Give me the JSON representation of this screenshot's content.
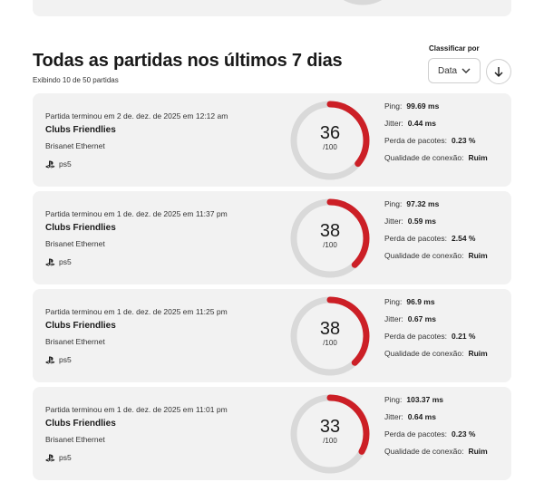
{
  "header": {
    "title": "Todas as partidas nos últimos 7 dias",
    "subtitle": "Exibindo 10 de 50 partidas",
    "sort_label": "Classificar por",
    "sort_value": "Data"
  },
  "colors": {
    "accent": "#cc1f26",
    "track": "#d9d9d9",
    "card": "#f2f2f2"
  },
  "labels": {
    "ping": "Ping:",
    "jitter": "Jitter:",
    "packet_loss": "Perda de pacotes:",
    "quality": "Qualidade de conexão:",
    "score_max": "/100"
  },
  "matches": [
    {
      "ended": "Partida terminou em 2 de. dez. de 2025 em 12:12 am",
      "mode": "Clubs Friendlies",
      "network": "Brisanet Ethernet",
      "platform": "ps5",
      "score": "36",
      "score_value": 36,
      "ping": "99.69 ms",
      "jitter": "0.44 ms",
      "loss": "0.23 %",
      "quality": "Ruim"
    },
    {
      "ended": "Partida terminou em 1 de. dez. de 2025 em 11:37 pm",
      "mode": "Clubs Friendlies",
      "network": "Brisanet Ethernet",
      "platform": "ps5",
      "score": "38",
      "score_value": 38,
      "ping": "97.32 ms",
      "jitter": "0.59 ms",
      "loss": "2.54 %",
      "quality": "Ruim"
    },
    {
      "ended": "Partida terminou em 1 de. dez. de 2025 em 11:25 pm",
      "mode": "Clubs Friendlies",
      "network": "Brisanet Ethernet",
      "platform": "ps5",
      "score": "38",
      "score_value": 38,
      "ping": "96.9 ms",
      "jitter": "0.67 ms",
      "loss": "0.21 %",
      "quality": "Ruim"
    },
    {
      "ended": "Partida terminou em 1 de. dez. de 2025 em 11:01 pm",
      "mode": "Clubs Friendlies",
      "network": "Brisanet Ethernet",
      "platform": "ps5",
      "score": "33",
      "score_value": 33,
      "ping": "103.37 ms",
      "jitter": "0.64 ms",
      "loss": "0.23 %",
      "quality": "Ruim"
    }
  ]
}
